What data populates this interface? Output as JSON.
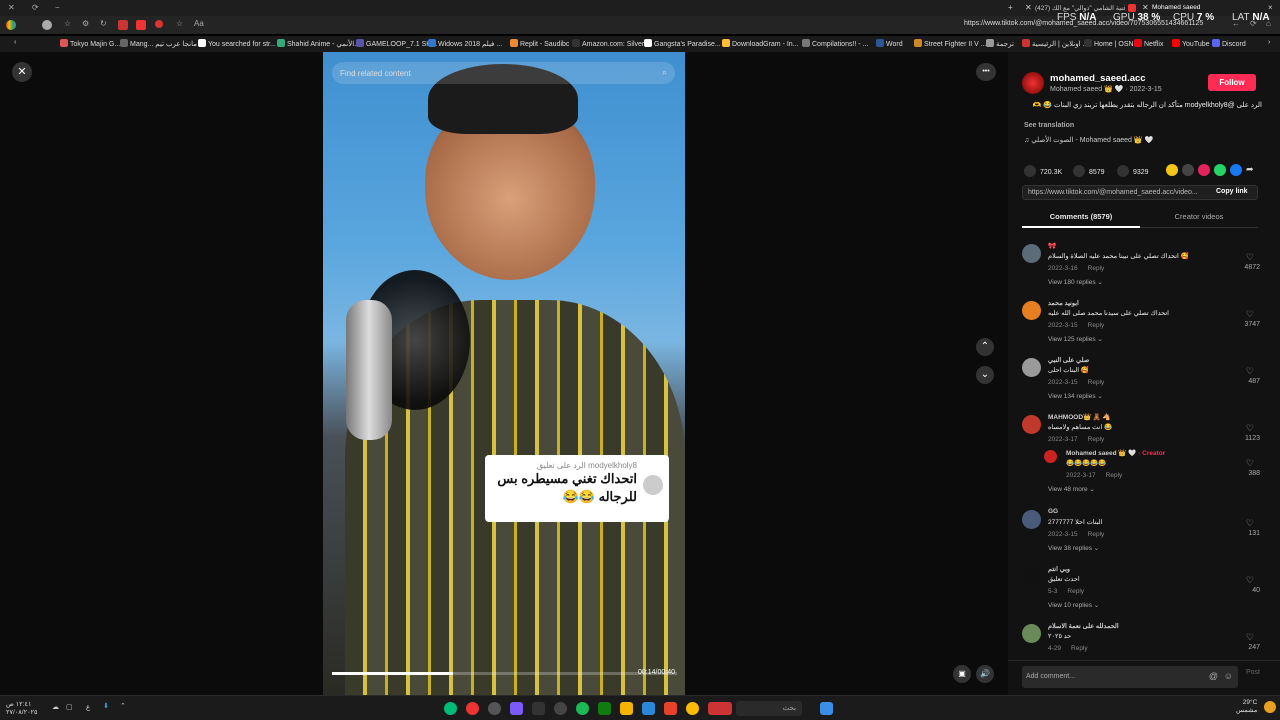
{
  "titlebar": {
    "tabs": [
      "Mohamed saeed",
      "(427) أغنية الشامي \"دوالي\" مع الك..."
    ],
    "window_controls": [
      "−",
      "×"
    ]
  },
  "navbar": {
    "url": "https://www.tiktok.com/@mohamed_saeed.acc/video/7075306551434661125"
  },
  "perf_overlay": {
    "fps_label": "FPS",
    "fps_value": "N/A",
    "gpu_label": "GPU",
    "gpu_value": "38 %",
    "cpu_label": "CPU",
    "cpu_value": "7 %",
    "lat_label": "LAT",
    "lat_value": "N/A"
  },
  "bookmarks": [
    "Tokyo Majin G...",
    "Mang... مانجا عرب تيم",
    "You searched for str...",
    "Shahid Anime - الأنمي...",
    "GAMELOOP_7.1 SH...",
    "Widows 2018 فيلم ...",
    "Replit - Saudibc",
    "Amazon.com: Silver...",
    "Gangsta's Paradise...",
    "DownloadGram - In...",
    "Compilations!! - ...",
    "Word",
    "Street Fighter II V ...",
    "ترجمة",
    "اونلاين | الرئيسية ...",
    "Home | OSN",
    "Netflix",
    "YouTube",
    "Discord"
  ],
  "video": {
    "search_placeholder": "Find related content",
    "reply_card": {
      "subtitle": "الرد على تعليق modyelkholy8",
      "text": "اتحداك تغني مسيطره بس للرجاله 😂😂"
    },
    "timecode": "00:14/00:40",
    "progress": 0.35
  },
  "controls": {
    "close": "✕",
    "more": "•••",
    "up": "⌃",
    "down": "⌄"
  },
  "author": {
    "username": "mohamed_saeed.acc",
    "display": "Mohamed saeed 👑 🤍 · 2022-3-15",
    "follow_label": "Follow",
    "caption": "الرد على @modyelkholy8 متأكد ان الرجاله بتقدر يطلعها تريند زي البنات 😂 🫶",
    "see_translation": "See translation",
    "sound": "الصوت الأصلي - Mohamed saeed 👑 🤍"
  },
  "stats": {
    "likes": "720.3K",
    "comments": "8579",
    "saves": "9329"
  },
  "share": {
    "url": "https://www.tiktok.com/@mohamed_saeed.acc/video...",
    "copy_label": "Copy link"
  },
  "tabs": {
    "comments": "Comments (8579)",
    "creator": "Creator videos"
  },
  "comments": [
    {
      "user": "🎀",
      "text": "اتحداك تصلي على نبينا محمد عليه الصلاة والسلام 🥰",
      "date": "2022-3-16",
      "reply": "Reply",
      "likes": "4872",
      "view": "View 180 replies ⌄",
      "color": "#5b6b78"
    },
    {
      "user": "ابونيد محمد",
      "text": "اتحداك تصلي على سيدنا محمد صلى الله عليه",
      "date": "2022-3-15",
      "reply": "Reply",
      "likes": "3747",
      "view": "View 125 replies ⌄",
      "color": "#e67e22"
    },
    {
      "user": "صلي على النبي",
      "text": "البنات احلى 🥰",
      "date": "2022-3-15",
      "reply": "Reply",
      "likes": "487",
      "view": "View 134 replies ⌄",
      "color": "#9a9a9a"
    },
    {
      "user": "MAHMOOD👑 🧸 🐴",
      "text": "انت مساهم ولامساه 😂",
      "date": "2022-3-17",
      "reply": "Reply",
      "likes": "1123",
      "view": "",
      "color": "#c0392b"
    },
    {
      "user": "GG",
      "text": "البنات احلا 2777777",
      "date": "2022-3-15",
      "reply": "Reply",
      "likes": "131",
      "view": "View 38 replies ⌄",
      "color": "#4a5a7a"
    },
    {
      "user": "وبي انتم",
      "text": "احدث تعليق",
      "date": "5-3",
      "reply": "Reply",
      "likes": "40",
      "view": "View 10 replies ⌄",
      "color": "#111"
    },
    {
      "user": "الحمدلله على نعمة الاسلام",
      "text": "حد ٢٠٢٥",
      "date": "4-29",
      "reply": "Reply",
      "likes": "247",
      "view": "",
      "color": "#6a8a5a"
    }
  ],
  "creator_reply": {
    "user": "Mohamed saeed 👑 🤍",
    "tag": "· Creator",
    "text": "😂😂😂😂😂",
    "date": "2022-3-17",
    "reply": "Reply",
    "likes": "388",
    "view": "View 48 more ⌄"
  },
  "add_comment": {
    "placeholder": "Add comment...",
    "post": "Post"
  },
  "taskbar": {
    "search": "بحث",
    "weather": "29°C",
    "weather_sub": "مشمس",
    "clock_time": "١٢:٤١ ص",
    "clock_date": "٢٧/٠٨/٢٠٢٥"
  },
  "colors": {
    "accent": "#fe2c55",
    "sidebar_bg": "#121212"
  }
}
